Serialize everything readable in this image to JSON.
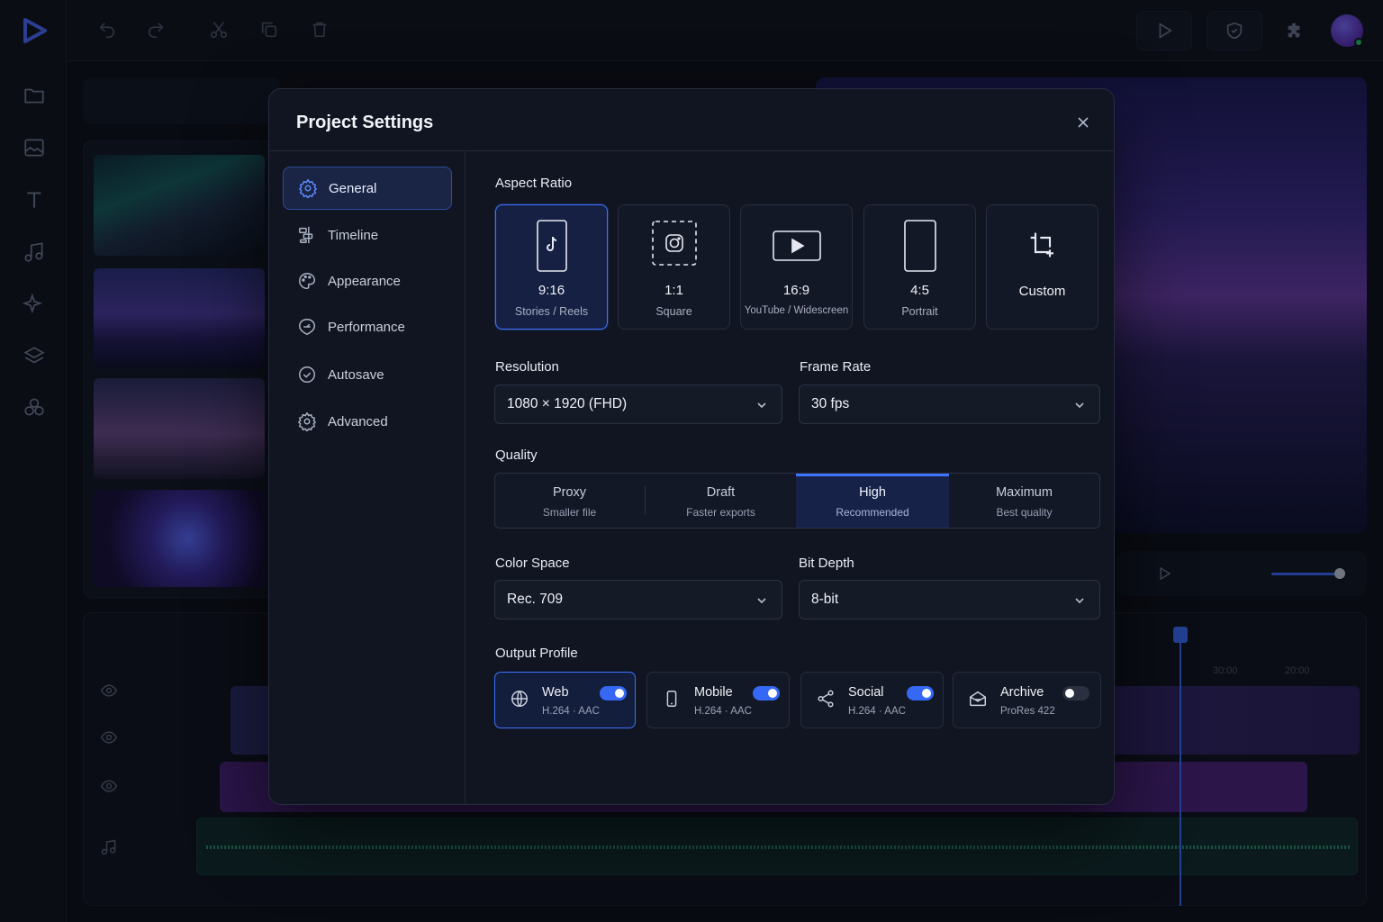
{
  "modal": {
    "title": "Project Settings",
    "close_icon": "close-icon"
  },
  "sidebar": {
    "items": [
      {
        "label": "General",
        "icon": "gear-icon",
        "active": true
      },
      {
        "label": "Timeline",
        "icon": "timeline-icon",
        "active": false
      },
      {
        "label": "Appearance",
        "icon": "palette-icon",
        "active": false
      },
      {
        "label": "Performance",
        "icon": "gauge-icon",
        "active": false
      },
      {
        "label": "Autosave",
        "icon": "clock-icon",
        "active": false
      },
      {
        "label": "Advanced",
        "icon": "cog-icon",
        "active": false
      }
    ]
  },
  "aspect_ratio": {
    "label": "Aspect Ratio",
    "options": [
      {
        "ratio": "9:16",
        "sub": "Stories / Reels",
        "icon": "tiktok-icon",
        "selected": true
      },
      {
        "ratio": "1:1",
        "sub": "Square",
        "icon": "instagram-icon",
        "selected": false
      },
      {
        "ratio": "16:9",
        "sub": "YouTube / Widescreen",
        "icon": "youtube-icon",
        "selected": false
      },
      {
        "ratio": "4:5",
        "sub": "Portrait",
        "icon": "portrait-icon",
        "selected": false
      },
      {
        "ratio": "Custom",
        "sub": "",
        "icon": "crop-icon",
        "selected": false
      }
    ]
  },
  "resolution": {
    "label": "Resolution",
    "value": "1080 × 1920 (FHD)"
  },
  "frame_rate": {
    "label": "Frame Rate",
    "value": "30 fps"
  },
  "quality": {
    "label": "Quality",
    "options": [
      {
        "title": "Proxy",
        "sub": "Smaller file",
        "selected": false
      },
      {
        "title": "Draft",
        "sub": "Faster exports",
        "selected": false
      },
      {
        "title": "High",
        "sub": "Recommended",
        "selected": true
      },
      {
        "title": "Maximum",
        "sub": "Best quality",
        "selected": false
      }
    ]
  },
  "color_space": {
    "label": "Color Space",
    "value": "Rec. 709"
  },
  "bit_depth": {
    "label": "Bit Depth",
    "value": "8-bit"
  },
  "output_profile": {
    "label": "Output Profile",
    "profiles": [
      {
        "title": "Web",
        "sub": "H.264 · AAC",
        "icon": "globe-icon",
        "enabled": true,
        "selected": true
      },
      {
        "title": "Mobile",
        "sub": "H.264 · AAC",
        "icon": "phone-icon",
        "enabled": true,
        "selected": false
      },
      {
        "title": "Social",
        "sub": "H.264 · AAC",
        "icon": "share-icon",
        "enabled": true,
        "selected": false
      },
      {
        "title": "Archive",
        "sub": "ProRes 422",
        "icon": "archive-icon",
        "enabled": false,
        "selected": false
      }
    ]
  },
  "timeline": {
    "ruler": [
      "00",
      "30:00",
      "20:00"
    ]
  },
  "colors": {
    "accent": "#3e73ff",
    "modal_bg": "#111521",
    "selected_bg": "#152042"
  }
}
